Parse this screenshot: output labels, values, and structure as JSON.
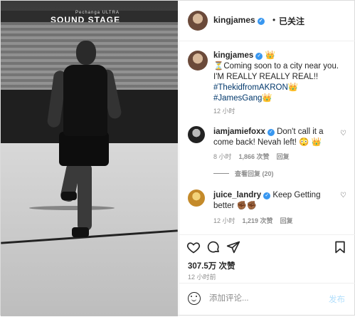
{
  "photo": {
    "banner_small": "Pechanga ULTRA",
    "banner_text": "SOUND STAGE"
  },
  "header": {
    "username": "kingjames",
    "separator": "•",
    "follow_label": "已关注"
  },
  "caption": {
    "username": "kingjames",
    "username_suffix": "👑",
    "text": "⏳Coming soon to a city near you. I'M REALLY REALLY REAL!!",
    "hashtag1": "#ThekidfromAKRON",
    "hashtag1_suffix": "👑",
    "hashtag2": "#JamesGang",
    "hashtag2_suffix": "👑",
    "time": "12 小时"
  },
  "comments": [
    {
      "username": "iamjamiefoxx",
      "text": "Don't call it a come back! Nevah left! 😳 👑",
      "time": "8 小时",
      "likes": "1,866 次赞",
      "reply": "回复",
      "view_replies": "查看回复 (20)"
    },
    {
      "username": "juice_landry",
      "text": "Keep Getting better ✊🏾✊🏾",
      "time": "12 小时",
      "likes": "1,219 次赞",
      "reply": "回复"
    }
  ],
  "post": {
    "likes": "307.5万 次赞",
    "time": "12 小时前"
  },
  "comment_box": {
    "placeholder": "添加评论...",
    "post_label": "发布"
  }
}
